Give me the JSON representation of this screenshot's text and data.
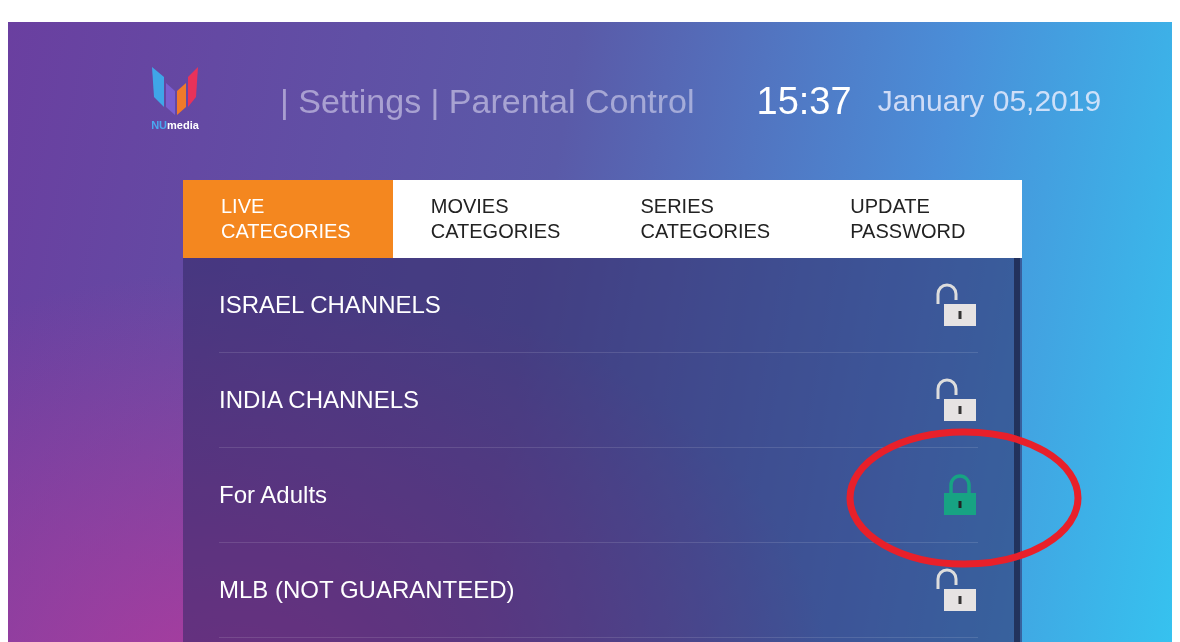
{
  "header": {
    "logo": {
      "accent": "NU",
      "text": "media"
    },
    "breadcrumb": "| Settings | Parental Control",
    "time": "15:37",
    "date": "January 05,2019"
  },
  "tabs": [
    {
      "label": "LIVE CATEGORIES",
      "selected": true
    },
    {
      "label": "MOVIES CATEGORIES",
      "selected": false
    },
    {
      "label": "SERIES CATEGORIES",
      "selected": false
    },
    {
      "label": "UPDATE PASSWORD",
      "selected": false
    }
  ],
  "categories": [
    {
      "name": "ISRAEL CHANNELS",
      "locked": false,
      "circled": false
    },
    {
      "name": "INDIA CHANNELS",
      "locked": false,
      "circled": false
    },
    {
      "name": "For Adults",
      "locked": true,
      "circled": true
    },
    {
      "name": "MLB (NOT GUARANTEED)",
      "locked": false,
      "circled": false
    }
  ]
}
